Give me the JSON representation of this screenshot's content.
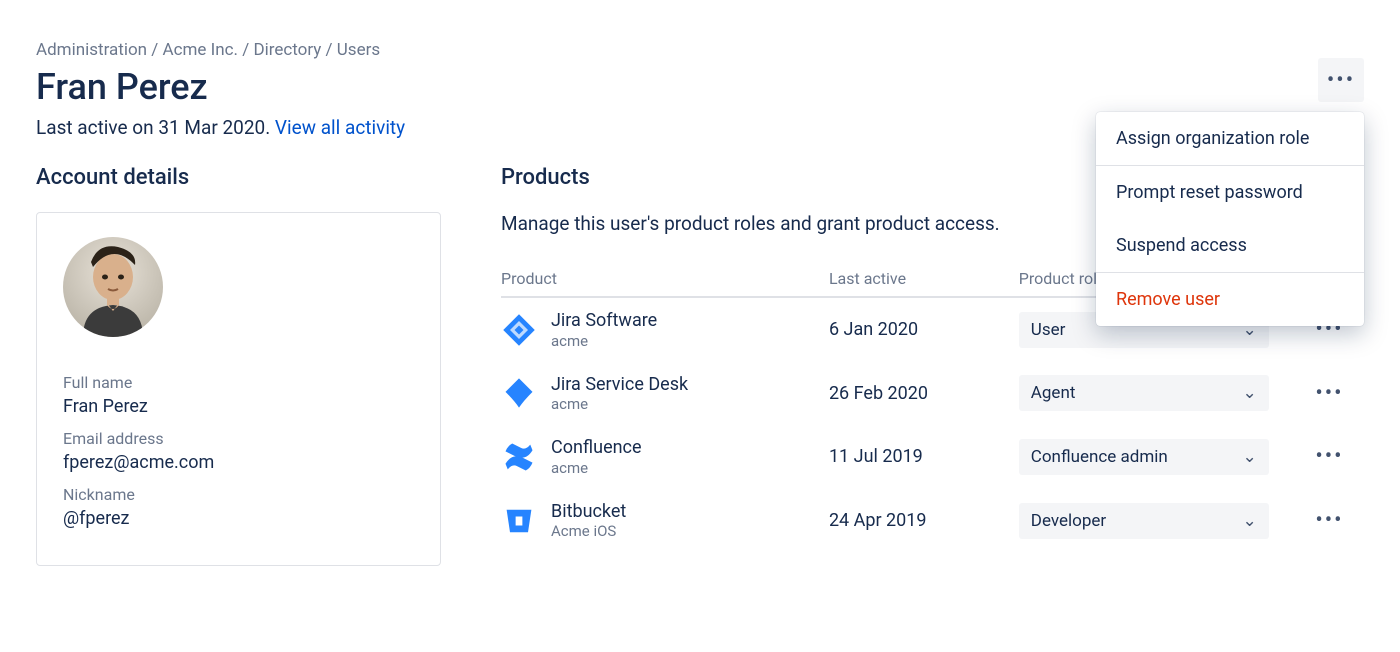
{
  "breadcrumb": {
    "parts": [
      "Administration",
      "Acme Inc.",
      "Directory",
      "Users"
    ],
    "sep": " / "
  },
  "page_title": "Fran Perez",
  "last_active_line": "Last active on 31 Mar 2020. ",
  "view_all_activity": "View all activity",
  "sections": {
    "account_details": "Account details",
    "products": "Products"
  },
  "account": {
    "full_name_label": "Full name",
    "full_name": "Fran Perez",
    "email_label": "Email address",
    "email": "fperez@acme.com",
    "nickname_label": "Nickname",
    "nickname": "@fperez"
  },
  "products_section": {
    "description": "Manage this user's product roles and grant product access.",
    "columns": {
      "product": "Product",
      "last_active": "Last active",
      "product_role": "Product role"
    },
    "rows": [
      {
        "icon": "jira-software-icon",
        "name": "Jira Software",
        "site": "acme",
        "last_active": "6 Jan 2020",
        "role": "User"
      },
      {
        "icon": "jira-service-desk-icon",
        "name": "Jira Service Desk",
        "site": "acme",
        "last_active": "26 Feb 2020",
        "role": "Agent"
      },
      {
        "icon": "confluence-icon",
        "name": "Confluence",
        "site": "acme",
        "last_active": "11 Jul 2019",
        "role": "Confluence admin"
      },
      {
        "icon": "bitbucket-icon",
        "name": "Bitbucket",
        "site": "Acme iOS",
        "last_active": "24 Apr 2019",
        "role": "Developer"
      }
    ]
  },
  "actions_menu": {
    "assign_org_role": "Assign organization role",
    "prompt_reset_password": "Prompt reset password",
    "suspend_access": "Suspend access",
    "remove_user": "Remove user"
  },
  "icons": {
    "more": "•••",
    "chevron_down": "⌄"
  },
  "colors": {
    "link": "#0052CC",
    "text": "#172B4D",
    "muted": "#6B778C",
    "danger": "#DE350B",
    "chip_bg": "#F4F5F7",
    "brand_blue": "#2684FF"
  }
}
